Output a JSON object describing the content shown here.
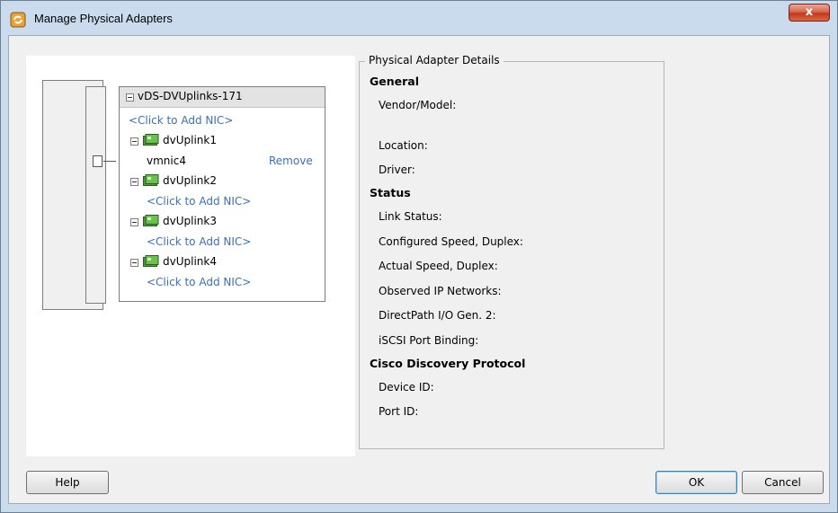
{
  "window": {
    "title": "Manage Physical Adapters",
    "close_label": "x"
  },
  "switch": {
    "name": "vDS-DVUplinks-171",
    "add_nic_label": "<Click to Add NIC>",
    "uplinks": [
      {
        "name": "dvUplink1",
        "nics": [
          {
            "name": "vmnic4",
            "remove_label": "Remove"
          }
        ]
      },
      {
        "name": "dvUplink2",
        "add_label": "<Click to Add NIC>"
      },
      {
        "name": "dvUplink3",
        "add_label": "<Click to Add NIC>"
      },
      {
        "name": "dvUplink4",
        "add_label": "<Click to Add NIC>"
      }
    ]
  },
  "details": {
    "legend": "Physical Adapter Details",
    "general_heading": "General",
    "vendor_model_label": "Vendor/Model:",
    "location_label": "Location:",
    "driver_label": "Driver:",
    "status_heading": "Status",
    "link_status_label": "Link Status:",
    "configured_speed_label": "Configured Speed, Duplex:",
    "actual_speed_label": "Actual Speed, Duplex:",
    "observed_ip_label": "Observed IP Networks:",
    "directpath_label": "DirectPath I/O Gen. 2:",
    "iscsi_label": "iSCSI Port Binding:",
    "cdp_heading": "Cisco Discovery Protocol",
    "device_id_label": "Device ID:",
    "port_id_label": "Port ID:"
  },
  "buttons": {
    "help": "Help",
    "ok": "OK",
    "cancel": "Cancel"
  },
  "colors": {
    "link": "#3d6fb3",
    "titlebar": "#c9dbed",
    "close_button": "#c0391f"
  }
}
